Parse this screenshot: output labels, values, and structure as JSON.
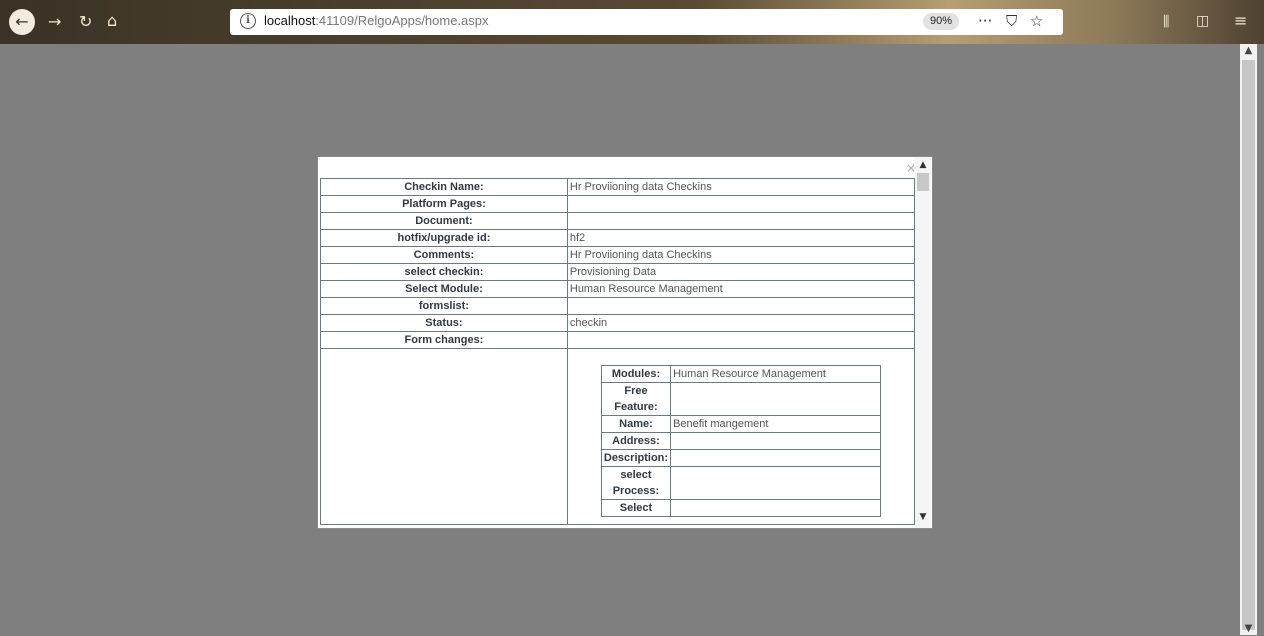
{
  "browser": {
    "url_host": "localhost",
    "url_path": ":41109/RelgoApps/home.aspx",
    "zoom": "90%",
    "icons": [
      "back-icon",
      "forward-icon",
      "reload-icon",
      "home-icon",
      "info-icon",
      "more-icon",
      "pocket-icon",
      "bookmark-star-icon",
      "library-icon",
      "sidebar-icon",
      "menu-icon"
    ]
  },
  "modal": {
    "close_glyph": "×",
    "rows": [
      {
        "label": "Checkin Name:",
        "value": "Hr Proviioning data Checkins"
      },
      {
        "label": "Platform Pages:",
        "value": ""
      },
      {
        "label": "Document:",
        "value": ""
      },
      {
        "label": "hotfix/upgrade id:",
        "value": "hf2"
      },
      {
        "label": "Comments:",
        "value": "Hr Proviioning data Checkins"
      },
      {
        "label": "select checkin:",
        "value": "Provisioning Data"
      },
      {
        "label": "Select Module:",
        "value": "Human Resource Management"
      },
      {
        "label": "formslist:",
        "value": ""
      },
      {
        "label": "Status:",
        "value": "checkin"
      },
      {
        "label": "Form changes:",
        "value": ""
      }
    ],
    "nested": [
      {
        "label": "Modules:",
        "value": "Human Resource Management"
      },
      {
        "label": "Free Feature:",
        "value": ""
      },
      {
        "label": "Name:",
        "value": "Benefit mangement"
      },
      {
        "label": "Address:",
        "value": ""
      },
      {
        "label": "Description:",
        "value": ""
      },
      {
        "label": "select Process:",
        "value": ""
      },
      {
        "label": "Select",
        "value": ""
      }
    ]
  }
}
